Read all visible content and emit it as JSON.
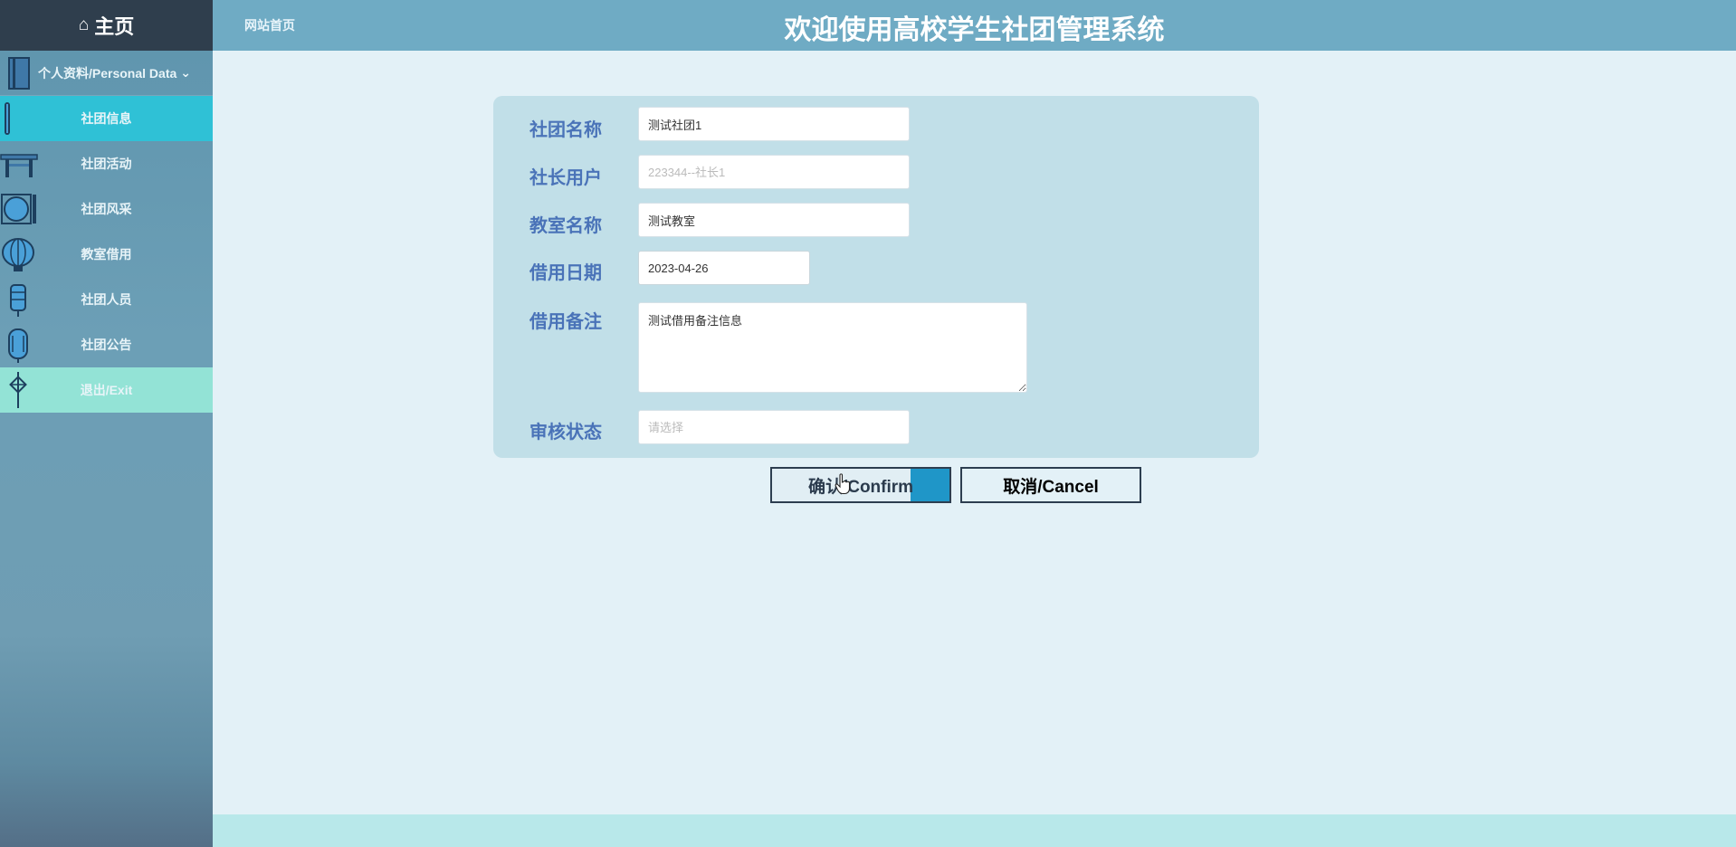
{
  "sidebar": {
    "home_label": "主页",
    "profile_label": "个人资料/Personal Data",
    "items": [
      {
        "label": "社团信息",
        "active": true
      },
      {
        "label": "社团活动"
      },
      {
        "label": "社团风采"
      },
      {
        "label": "教室借用"
      },
      {
        "label": "社团人员"
      },
      {
        "label": "社团公告"
      },
      {
        "label": "退出/Exit"
      }
    ]
  },
  "header": {
    "home_link": "网站首页",
    "title": "欢迎使用高校学生社团管理系统"
  },
  "form": {
    "club_name": {
      "label": "社团名称",
      "value": "测试社团1"
    },
    "leader_user": {
      "label": "社长用户",
      "placeholder": "223344--社长1"
    },
    "classroom_name": {
      "label": "教室名称",
      "value": "测试教室"
    },
    "borrow_date": {
      "label": "借用日期",
      "value": "2023-04-26"
    },
    "borrow_note": {
      "label": "借用备注",
      "value": "测试借用备注信息"
    },
    "review_status": {
      "label": "审核状态",
      "placeholder": "请选择"
    }
  },
  "buttons": {
    "confirm": "确认/Confirm",
    "cancel": "取消/Cancel"
  },
  "colors": {
    "sidebar_active": "#2fc1d6",
    "sidebar_exit": "#93e3d6",
    "header_bg": "#6fabc4",
    "label_color": "#4a73b8"
  }
}
